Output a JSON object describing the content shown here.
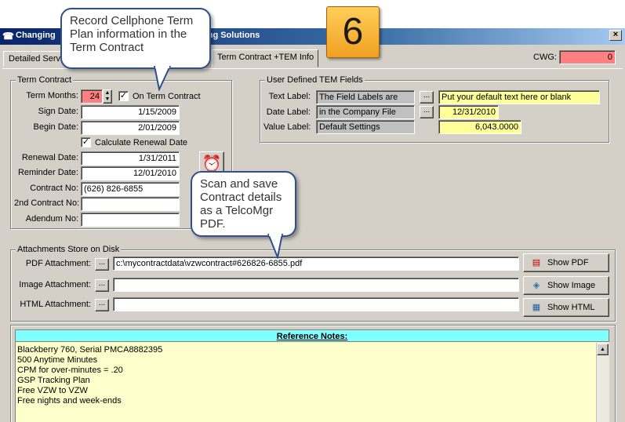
{
  "window": {
    "title_left": "Changing",
    "title_right": "ting Solutions",
    "close_label": "×"
  },
  "step_badge": "6",
  "tabs": {
    "detail": "Detailed Serv",
    "contract": "Term Contract +TEM Info"
  },
  "cwg": {
    "label": "CWG:",
    "value": "0"
  },
  "term_contract": {
    "group_title": "Term Contract",
    "term_months_label": "Term Months:",
    "term_months_value": "24",
    "on_term_label": "On Term Contract",
    "sign_date_label": "Sign Date:",
    "sign_date": "1/15/2009",
    "begin_date_label": "Begin Date:",
    "begin_date": "2/01/2009",
    "calc_renewal_label": "Calculate Renewal Date",
    "renewal_date_label": "Renewal Date:",
    "renewal_date": "1/31/2011",
    "reminder_date_label": "Reminder Date:",
    "reminder_date": "12/01/2010",
    "contract_no_label": "Contract No:",
    "contract_no": "(626)  826-6855",
    "contract2_label": "2nd Contract No:",
    "contract2": "",
    "addendum_label": "Adendum No:",
    "addendum": ""
  },
  "tem_fields": {
    "group_title": "User Defined TEM Fields",
    "text_label": "Text Label:",
    "text_label_name": "The Field Labels are",
    "text_value": "Put your default text here or blank",
    "date_label": "Date Label:",
    "date_label_name": "in the Company File",
    "date_value": "12/31/2010",
    "value_label": "Value Label:",
    "value_label_name": "Default Settings",
    "value_value": "6,043.0000"
  },
  "attachments": {
    "group_title": "Attachments Store on Disk",
    "pdf_label": "PDF Attachment:",
    "pdf_path": "c:\\mycontractdata\\vzwcontract#626826-6855.pdf",
    "image_label": "Image Attachment:",
    "image_path": "",
    "html_label": "HTML Attachment:",
    "html_path": "",
    "show_pdf": "Show PDF",
    "show_image": "Show Image",
    "show_html": "Show HTML",
    "browse": "..."
  },
  "notes": {
    "header": "Reference Notes:",
    "lines": [
      "Blackberry 760, Serial PMCA8882395",
      "500 Anytime Minutes",
      "CPM for over-minutes = .20",
      "GSP Tracking Plan",
      "Free VZW to VZW",
      "Free nights and week-ends"
    ]
  },
  "callouts": {
    "top": "Record Cellphone Term Plan information in the Term Contract",
    "mid": "Scan and save Contract details as a TelcoMgr PDF."
  },
  "colors": {
    "cwg_bg": "#ff8080",
    "term_months_bg": "#ff8080",
    "yellow_field": "#ffff99",
    "notes_header": "#80ffff",
    "notes_bg": "#ffffcc"
  }
}
